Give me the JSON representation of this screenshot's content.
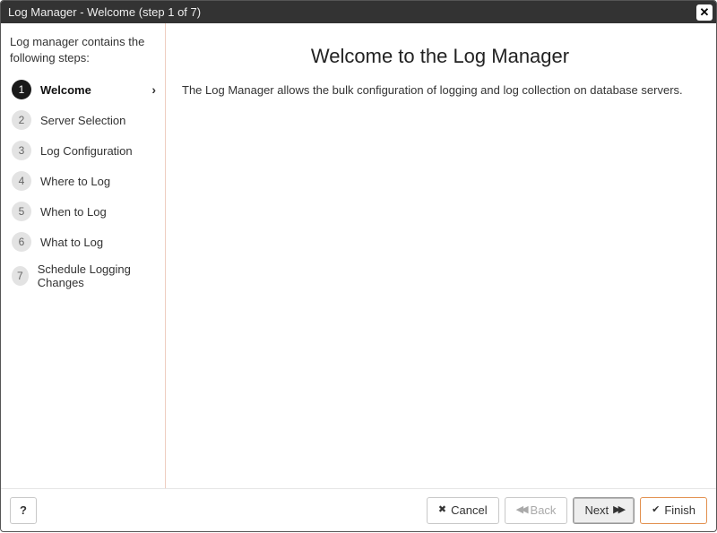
{
  "titlebar": {
    "text": "Log Manager - Welcome (step 1 of 7)"
  },
  "sidebar": {
    "intro": "Log manager contains the following steps:",
    "steps": [
      {
        "n": "1",
        "label": "Welcome",
        "active": true
      },
      {
        "n": "2",
        "label": "Server Selection"
      },
      {
        "n": "3",
        "label": "Log Configuration"
      },
      {
        "n": "4",
        "label": "Where to Log"
      },
      {
        "n": "5",
        "label": "When to Log"
      },
      {
        "n": "6",
        "label": "What to Log"
      },
      {
        "n": "7",
        "label": "Schedule Logging Changes"
      }
    ]
  },
  "main": {
    "heading": "Welcome to the Log Manager",
    "body": "The Log Manager allows the bulk configuration of logging and log collection on database servers."
  },
  "footer": {
    "help": "?",
    "cancel": "Cancel",
    "back": "Back",
    "next": "Next",
    "finish": "Finish"
  }
}
